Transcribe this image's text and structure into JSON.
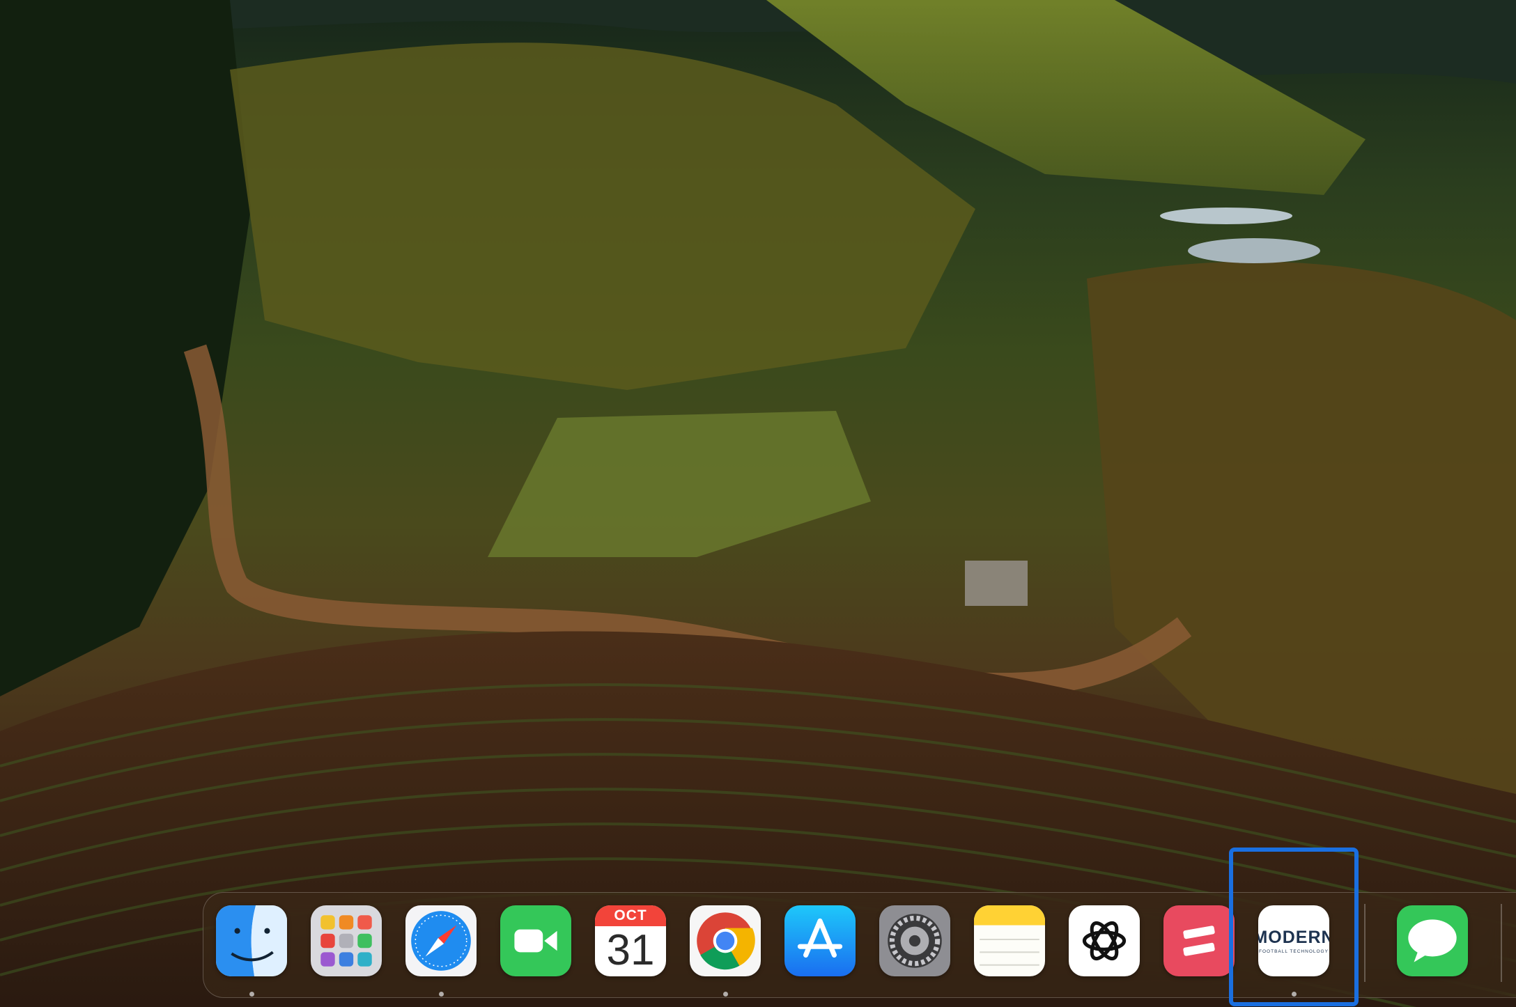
{
  "desktop": {
    "wallpaper": "vineyard-hillside-landscape"
  },
  "dock": {
    "apps": [
      {
        "name": "Finder",
        "icon": "finder-icon",
        "running": true
      },
      {
        "name": "Launchpad",
        "icon": "launchpad-icon",
        "running": false
      },
      {
        "name": "Safari",
        "icon": "safari-icon",
        "running": true
      },
      {
        "name": "FaceTime",
        "icon": "facetime-icon",
        "running": false
      },
      {
        "name": "Calendar",
        "icon": "calendar-icon",
        "running": false,
        "month": "OCT",
        "day": "31"
      },
      {
        "name": "Google Chrome",
        "icon": "chrome-icon",
        "running": true
      },
      {
        "name": "App Store",
        "icon": "app-store-icon",
        "running": false
      },
      {
        "name": "System Settings",
        "icon": "settings-gear-icon",
        "running": false
      },
      {
        "name": "Notes",
        "icon": "notes-icon",
        "running": false
      },
      {
        "name": "ChatGPT",
        "icon": "chatgpt-icon",
        "running": false
      },
      {
        "name": "Toggl",
        "icon": "toggl-icon",
        "running": false
      },
      {
        "name": "Modern Football Technology",
        "icon": "modern-app-icon",
        "running": true,
        "logo_text": "MODERN",
        "logo_subtext": "FOOTBALL TECHNOLOGY"
      },
      {
        "name": "Messages",
        "icon": "messages-icon",
        "running": false
      }
    ],
    "highlighted_app": "Modern Football Technology",
    "highlight_color": "#1a6fe0"
  }
}
